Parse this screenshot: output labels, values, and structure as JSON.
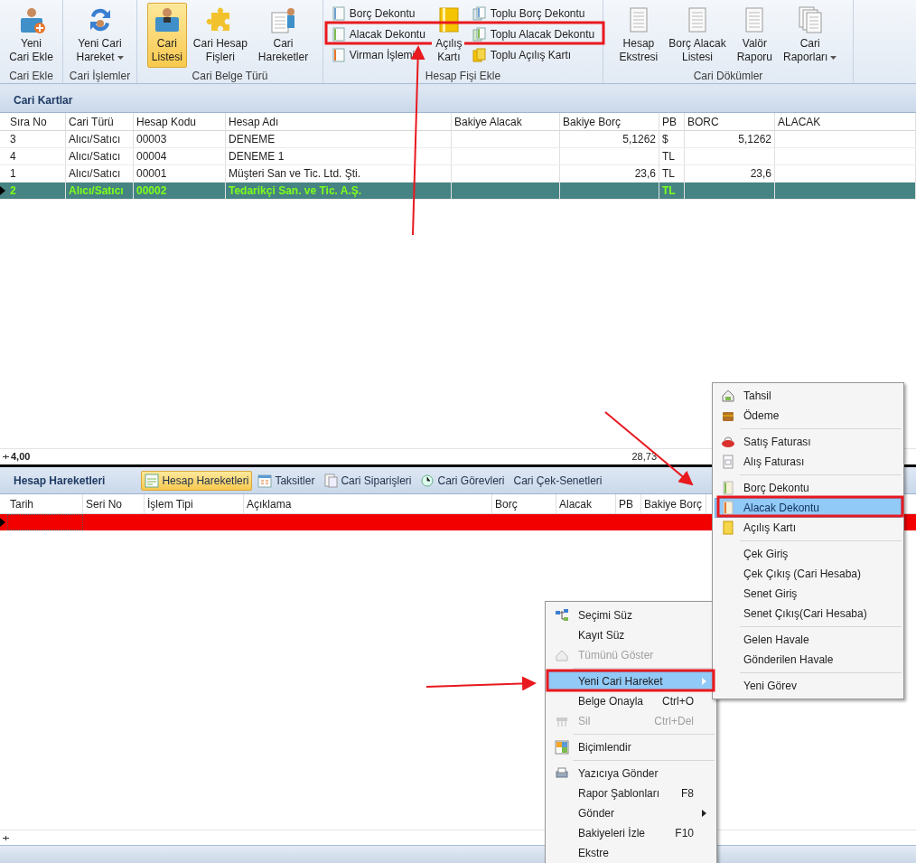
{
  "ribbon": {
    "groups": [
      {
        "label": "Cari Ekle",
        "items": [
          {
            "label": "Yeni\nCari Ekle",
            "kind": "large",
            "selected": false,
            "dropdown": false
          }
        ]
      },
      {
        "label": "Cari İşlemler",
        "items": [
          {
            "label": "Yeni Cari\nHareket",
            "kind": "large",
            "selected": false,
            "dropdown": true
          }
        ]
      },
      {
        "label": "Cari Belge Türü",
        "items": [
          {
            "label": "Cari\nListesi",
            "kind": "large",
            "selected": true,
            "dropdown": false
          },
          {
            "label": "Cari Hesap\nFişleri",
            "kind": "large",
            "selected": false,
            "dropdown": false
          },
          {
            "label": "Cari\nHareketler",
            "kind": "large",
            "selected": false,
            "dropdown": false
          }
        ]
      },
      {
        "label": "Hesap Fişi Ekle",
        "items": [
          {
            "label": "Borç Dekontu",
            "kind": "small",
            "selected": false,
            "dropdown": false
          },
          {
            "label": "Alacak Dekontu",
            "kind": "small",
            "selected": false,
            "dropdown": false
          },
          {
            "label": "Virman İşlemi",
            "kind": "small",
            "selected": false,
            "dropdown": false
          },
          {
            "label": "Açılış\nKartı",
            "kind": "large",
            "selected": false,
            "dropdown": false
          },
          {
            "label": "Toplu Borç Dekontu",
            "kind": "small",
            "selected": false,
            "dropdown": false
          },
          {
            "label": "Toplu Alacak Dekontu",
            "kind": "small",
            "selected": false,
            "dropdown": false
          },
          {
            "label": "Toplu Açılış Kartı",
            "kind": "small",
            "selected": false,
            "dropdown": false
          }
        ]
      },
      {
        "label": "Cari Dökümler",
        "items": [
          {
            "label": "Hesap\nEkstresi",
            "kind": "large",
            "selected": false,
            "dropdown": false
          },
          {
            "label": "Borç Alacak\nListesi",
            "kind": "large",
            "selected": false,
            "dropdown": false
          },
          {
            "label": "Valör\nRaporu",
            "kind": "large",
            "selected": false,
            "dropdown": false
          },
          {
            "label": "Cari\nRaporları",
            "kind": "large",
            "selected": false,
            "dropdown": true
          }
        ]
      }
    ]
  },
  "cari_kartlar": {
    "title": "Cari Kartlar",
    "columns": [
      "Sıra No",
      "Cari Türü",
      "Hesap Kodu",
      "Hesap Adı",
      "Bakiye Alacak",
      "Bakiye Borç",
      "PB",
      "BORC",
      "ALACAK"
    ],
    "rows": [
      {
        "selected": false,
        "cells": [
          "3",
          "Alıcı/Satıcı",
          "00003",
          "DENEME",
          "",
          "5,1262",
          "$",
          "5,1262",
          ""
        ]
      },
      {
        "selected": false,
        "cells": [
          "4",
          "Alıcı/Satıcı",
          "00004",
          "DENEME 1",
          "",
          "",
          "TL",
          "",
          ""
        ]
      },
      {
        "selected": false,
        "cells": [
          "1",
          "Alıcı/Satıcı",
          "00001",
          "Müşteri San ve Tic. Ltd. Şti.",
          "",
          "23,6",
          "TL",
          "23,6",
          ""
        ]
      },
      {
        "selected": true,
        "cells": [
          "2",
          "Alıcı/Satıcı",
          "00002",
          "Tedarikçi San. ve Tic. A.Ş.",
          "",
          "",
          "TL",
          "",
          ""
        ]
      }
    ],
    "footer": {
      "count": "4,00",
      "total": "28,73"
    }
  },
  "hesap_hareketleri": {
    "title": "Hesap Hareketleri",
    "tabs": [
      {
        "label": "Hesap Hareketleri",
        "selected": true,
        "has_icon": true
      },
      {
        "label": "Taksitler",
        "selected": false,
        "has_icon": true
      },
      {
        "label": "Cari Siparişleri",
        "selected": false,
        "has_icon": true
      },
      {
        "label": "Cari Görevleri",
        "selected": false,
        "has_icon": true
      },
      {
        "label": "Cari Çek-Senetleri",
        "selected": false,
        "has_icon": false
      }
    ],
    "columns": [
      "Tarih",
      "Seri No",
      "İşlem Tipi",
      "Açıklama",
      "Borç",
      "Alacak",
      "PB",
      "Bakiye Borç"
    ]
  },
  "context_menu": [
    {
      "label": "Seçimi Süz",
      "has_icon": true,
      "disabled": false,
      "selected": false,
      "submenu": false,
      "separator_before": false
    },
    {
      "label": "Kayıt Süz",
      "has_icon": false,
      "disabled": false,
      "selected": false,
      "submenu": false,
      "separator_before": false
    },
    {
      "label": "Tümünü Göster",
      "has_icon": true,
      "disabled": true,
      "selected": false,
      "submenu": false,
      "separator_before": false
    },
    {
      "label": "Yeni Cari Hareket",
      "has_icon": false,
      "disabled": false,
      "selected": true,
      "submenu": true,
      "separator_before": true
    },
    {
      "label": "Belge Onayla",
      "shortcut": "Ctrl+O",
      "has_icon": false,
      "disabled": false,
      "selected": false,
      "submenu": false,
      "separator_before": false
    },
    {
      "label": "Sil",
      "shortcut": "Ctrl+Del",
      "has_icon": true,
      "disabled": true,
      "selected": false,
      "submenu": false,
      "separator_before": false
    },
    {
      "label": "Biçimlendir",
      "has_icon": true,
      "disabled": false,
      "selected": false,
      "submenu": false,
      "separator_before": true
    },
    {
      "label": "Yazıcıya Gönder",
      "has_icon": true,
      "disabled": false,
      "selected": false,
      "submenu": false,
      "separator_before": true
    },
    {
      "label": "Rapor Şablonları",
      "shortcut": "F8",
      "has_icon": false,
      "disabled": false,
      "selected": false,
      "submenu": false,
      "separator_before": false
    },
    {
      "label": "Gönder",
      "has_icon": false,
      "disabled": false,
      "selected": false,
      "submenu": true,
      "separator_before": false
    },
    {
      "label": "Bakiyeleri İzle",
      "shortcut": "F10",
      "has_icon": false,
      "disabled": false,
      "selected": false,
      "submenu": false,
      "separator_before": false
    },
    {
      "label": "Ekstre",
      "has_icon": false,
      "disabled": false,
      "selected": false,
      "submenu": false,
      "separator_before": false
    }
  ],
  "submenu": [
    {
      "label": "Tahsil",
      "has_icon": true,
      "selected": false,
      "separator_before": false
    },
    {
      "label": "Ödeme",
      "has_icon": true,
      "selected": false,
      "separator_before": false
    },
    {
      "label": "Satış Faturası",
      "has_icon": true,
      "selected": false,
      "separator_before": true
    },
    {
      "label": "Alış Faturası",
      "has_icon": true,
      "selected": false,
      "separator_before": false
    },
    {
      "label": "Borç Dekontu",
      "has_icon": true,
      "selected": false,
      "separator_before": true
    },
    {
      "label": "Alacak Dekontu",
      "has_icon": true,
      "selected": true,
      "separator_before": false
    },
    {
      "label": "Açılış Kartı",
      "has_icon": true,
      "selected": false,
      "separator_before": false
    },
    {
      "label": "Çek Giriş",
      "has_icon": false,
      "selected": false,
      "separator_before": true
    },
    {
      "label": "Çek Çıkış (Cari Hesaba)",
      "has_icon": false,
      "selected": false,
      "separator_before": false
    },
    {
      "label": "Senet Giriş",
      "has_icon": false,
      "selected": false,
      "separator_before": false
    },
    {
      "label": "Senet Çıkış(Cari Hesaba)",
      "has_icon": false,
      "selected": false,
      "separator_before": false
    },
    {
      "label": "Gelen Havale",
      "has_icon": false,
      "selected": false,
      "separator_before": true
    },
    {
      "label": "Gönderilen Havale",
      "has_icon": false,
      "selected": false,
      "separator_before": false
    },
    {
      "label": "Yeni Görev",
      "has_icon": false,
      "selected": false,
      "separator_before": true
    }
  ]
}
